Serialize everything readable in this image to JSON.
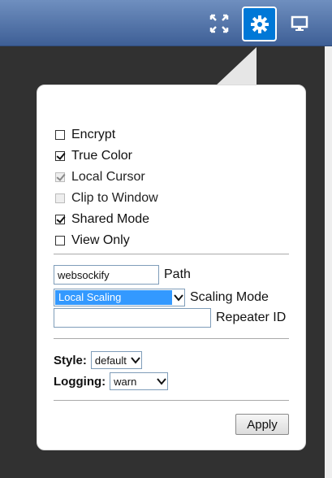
{
  "toolbar": {
    "fullscreen_icon": "fullscreen-icon",
    "settings_icon": "gear-icon",
    "display_icon": "monitor-icon"
  },
  "settings": {
    "options": [
      {
        "label": "Encrypt",
        "checked": false,
        "disabled": false
      },
      {
        "label": "True Color",
        "checked": true,
        "disabled": false
      },
      {
        "label": "Local Cursor",
        "checked": true,
        "disabled": true
      },
      {
        "label": "Clip to Window",
        "checked": false,
        "disabled": true
      },
      {
        "label": "Shared Mode",
        "checked": true,
        "disabled": false
      },
      {
        "label": "View Only",
        "checked": false,
        "disabled": false
      }
    ],
    "path": {
      "value": "websockify",
      "label": "Path"
    },
    "scaling": {
      "value": "Local Scaling",
      "label": "Scaling Mode"
    },
    "repeater": {
      "value": "",
      "label": "Repeater ID"
    },
    "style": {
      "label": "Style:",
      "value": "default"
    },
    "logging": {
      "label": "Logging:",
      "value": "warn"
    },
    "apply_label": "Apply"
  },
  "colors": {
    "toolbar_top": "#6f8fbf",
    "toolbar_bottom": "#3e5f96",
    "active_button": "#0078d7",
    "background": "#313131",
    "selection": "#3399ff"
  }
}
